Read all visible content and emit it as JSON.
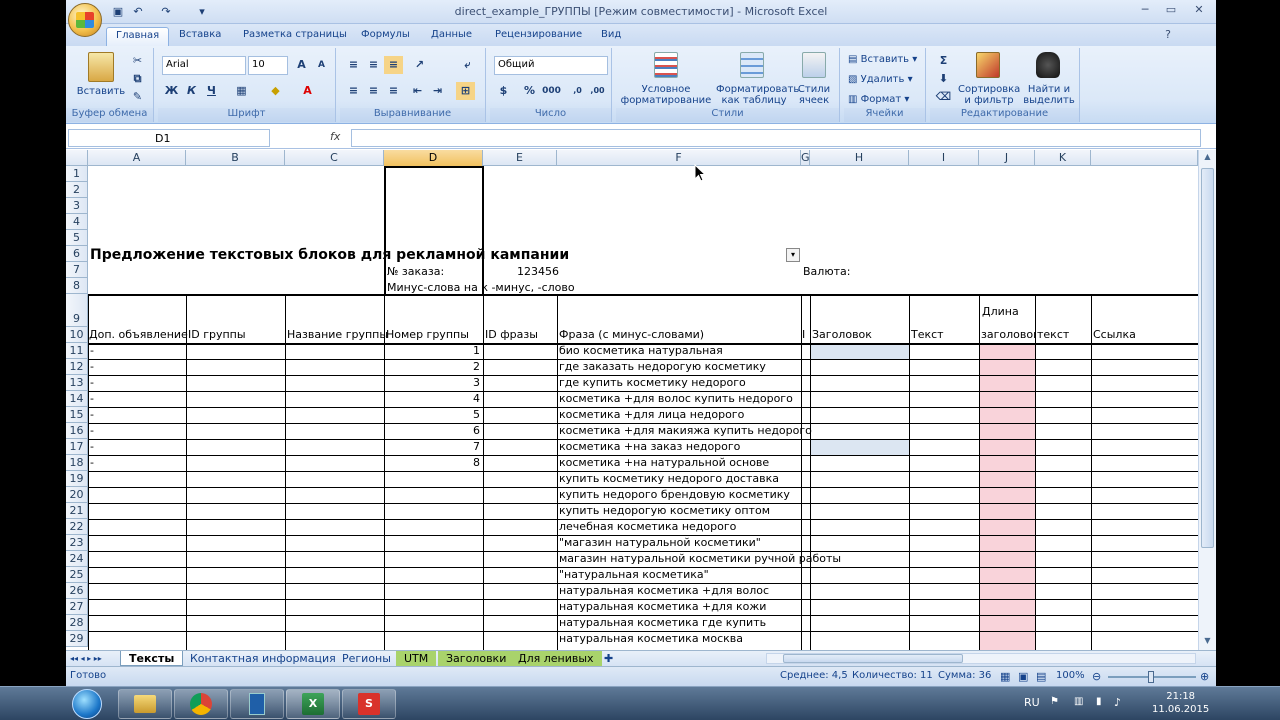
{
  "window": {
    "title": "direct_example_ГРУППЫ  [Режим совместимости] - Microsoft Excel"
  },
  "ribbon_tabs": [
    "Главная",
    "Вставка",
    "Разметка страницы",
    "Формулы",
    "Данные",
    "Рецензирование",
    "Вид"
  ],
  "ribbon": {
    "paste": "Вставить",
    "clipboard_group": "Буфер обмена",
    "font_name": "Arial",
    "font_size": "10",
    "font_group": "Шрифт",
    "align_group": "Выравнивание",
    "number_format": "Общий",
    "number_group": "Число",
    "cond_format": "Условное форматирование",
    "format_table": "Форматировать как таблицу",
    "cell_styles": "Стили ячеек",
    "styles_group": "Стили",
    "insert": "Вставить",
    "delete": "Удалить",
    "format": "Формат",
    "cells_group": "Ячейки",
    "sort": "Сортировка и фильтр",
    "find": "Найти и выделить",
    "edit_group": "Редактирование"
  },
  "formula_bar": {
    "name_box": "D1",
    "fx": "fx",
    "value": ""
  },
  "columns": [
    "A",
    "B",
    "C",
    "D",
    "E",
    "F",
    "G",
    "H",
    "I",
    "J",
    "K"
  ],
  "rows": [
    "1",
    "2",
    "3",
    "4",
    "5",
    "6",
    "7",
    "8",
    "9",
    "10",
    "11",
    "12",
    "13",
    "14",
    "15",
    "16",
    "17",
    "18",
    "19",
    "20",
    "21",
    "22",
    "23",
    "24",
    "25",
    "26",
    "27",
    "28",
    "29"
  ],
  "sheet": {
    "title": "Предложение текстовых блоков для рекламной кампании",
    "order_label": "№ заказа:",
    "order_value": "123456",
    "minus_words": "Минус-слова на к -минус, -слово",
    "currency_label": "Валюта:",
    "length_label": "Длина",
    "headers": {
      "ad": "Доп. объявление",
      "group_id": "ID группы",
      "group_name": "Название группы",
      "group_num": "Номер группы",
      "phrase_id": "ID фразы",
      "phrase": "Фраза (с минус-словами)",
      "g": "I",
      "title": "Заголовок",
      "text": "Текст",
      "len_title": "заголовок",
      "len_text": "текст",
      "link": "Ссылка"
    },
    "dashes": [
      "-",
      "-",
      "-",
      "-",
      "-",
      "-",
      "-",
      "-"
    ],
    "group_numbers": [
      "1",
      "2",
      "3",
      "4",
      "5",
      "6",
      "7",
      "8"
    ],
    "phrases": [
      "био косметика натуральная",
      "где заказать недорогую косметику",
      "где купить косметику недорого",
      "косметика +для волос купить недорого",
      "косметика +для лица недорого",
      "косметика +для макияжа купить недорого",
      "косметика +на заказ недорого",
      "косметика +на натуральной основе",
      "купить косметику недорого доставка",
      "купить недорого брендовую косметику",
      "купить недорогую косметику оптом",
      "лечебная косметика недорого",
      "\"магазин натуральной косметики\"",
      "магазин натуральной косметики ручной работы",
      "\"натуральная косметика\"",
      "натуральная косметика +для волос",
      "натуральная косметика +для кожи",
      "натуральная косметика где купить",
      "натуральная косметика москва"
    ]
  },
  "sheet_tabs": [
    "Тексты",
    "Контактная информация",
    "Регионы",
    "UTM",
    "Заголовки",
    "Для ленивых"
  ],
  "status": {
    "ready": "Готово",
    "average": "Среднее: 4,5",
    "count": "Количество: 11",
    "sum": "Сумма: 36",
    "zoom": "100%"
  },
  "taskbar": {
    "lang": "RU",
    "time": "21:18",
    "date": "11.06.2015"
  },
  "colors": {
    "selected_header": "#f1c15f",
    "pink_fill": "#f9d3da",
    "blue_fill": "#dce6f2",
    "green_tab": "#a9d36b"
  }
}
